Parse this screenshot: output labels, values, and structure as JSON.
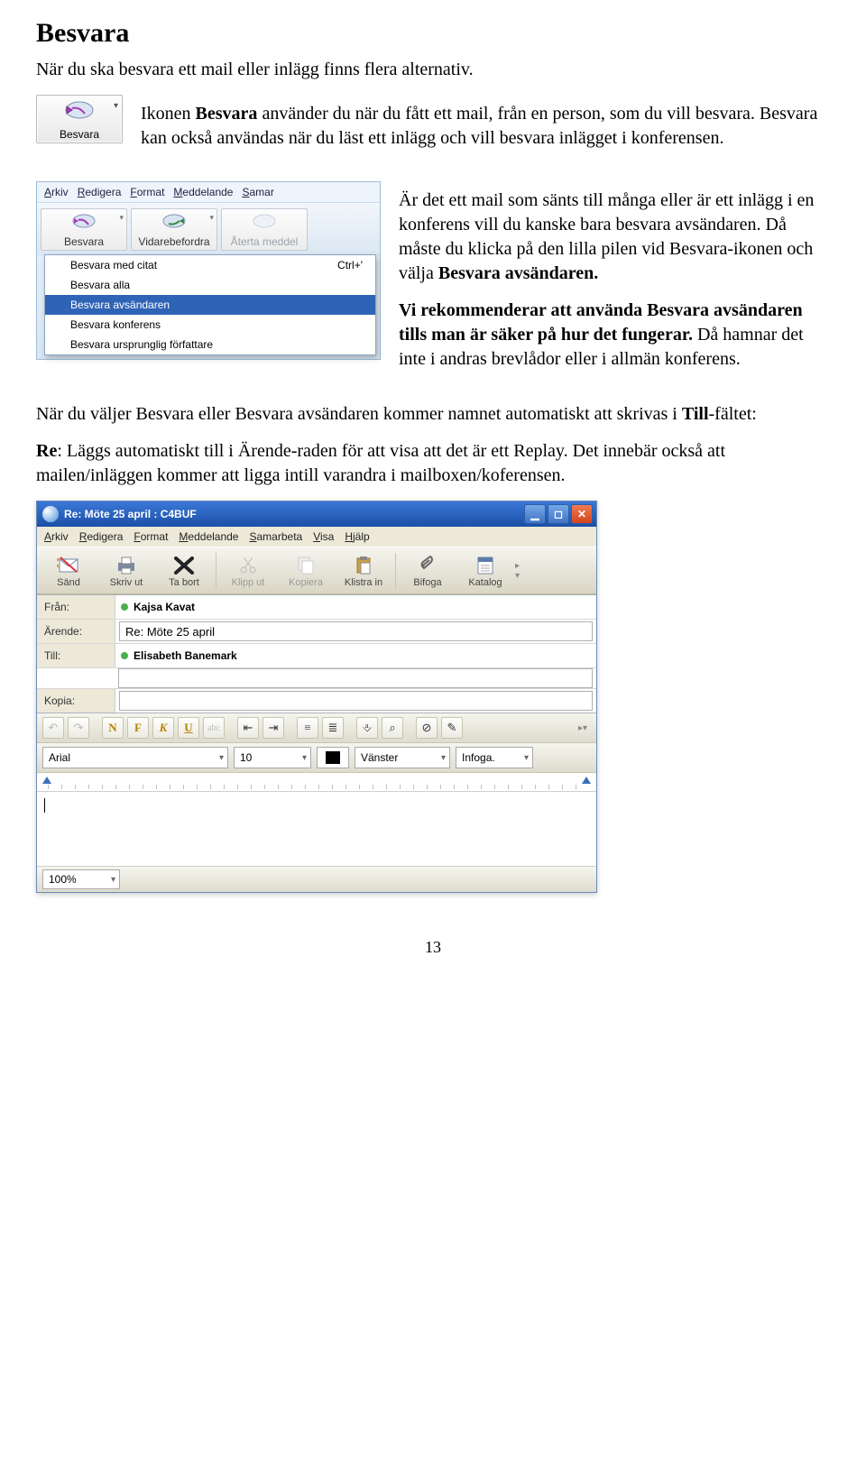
{
  "heading": "Besvara",
  "intro": "När du ska besvara ett mail eller inlägg finns flera alternativ.",
  "para1a": "Ikonen ",
  "para1b": "Besvara",
  "para1c": " använder du när du fått ett mail, från en person, som du vill besvara. Besvara kan också användas när du läst ett inlägg och vill besvara inlägget i konferensen.",
  "para2a": "Är det ett mail som sänts till många eller är ett inlägg i en konferens vill du kanske bara besvara avsändaren. Då måste du klicka på den lilla pilen vid Besvara-ikonen och välja ",
  "para2b": "Besvara avsändaren.",
  "para3a": "Vi rekommenderar att använda Besvara avsändaren tills man är säker på hur det fungerar.",
  "para3b": " Då hamnar det inte i andras brevlådor eller i allmän konferens.",
  "para4a": "När du väljer Besvara eller Besvara avsändaren kommer namnet automatiskt att skrivas i ",
  "para4b": "Till",
  "para4c": "-fältet:",
  "para5a": "Re",
  "para5b": ": Läggs automatiskt till i Ärende-raden för att visa att det är ett Replay. Det innebär också att mailen/inläggen kommer att ligga intill varandra i mailboxen/koferensen.",
  "besvara_btn_label": "Besvara",
  "menu_shot": {
    "menubar": [
      "Arkiv",
      "Redigera",
      "Format",
      "Meddelande",
      "Samar"
    ],
    "toolbar": [
      {
        "label": "Besvara",
        "sub": true
      },
      {
        "label": "Vidarebefordra",
        "sub": true
      },
      {
        "label": "Återta meddel",
        "faded": true
      }
    ],
    "dropdown": [
      {
        "label": "Besvara med citat",
        "shortcut": "Ctrl+'"
      },
      {
        "label": "Besvara alla"
      },
      {
        "label": "Besvara avsändaren",
        "selected": true
      },
      {
        "label": "Besvara konferens"
      },
      {
        "label": "Besvara ursprunglig författare"
      }
    ]
  },
  "compose": {
    "title": "Re: Möte 25 april : C4BUF",
    "menubar": [
      "Arkiv",
      "Redigera",
      "Format",
      "Meddelande",
      "Samarbeta",
      "Visa",
      "Hjälp"
    ],
    "toolbar": [
      {
        "label": "Sänd"
      },
      {
        "label": "Skriv ut"
      },
      {
        "label": "Ta bort"
      },
      {
        "label": "Klipp ut",
        "faded": true
      },
      {
        "label": "Kopiera",
        "faded": true
      },
      {
        "label": "Klistra in"
      },
      {
        "label": "Bifoga"
      },
      {
        "label": "Katalog"
      }
    ],
    "headers": {
      "from_label": "Från:",
      "from_value": "Kajsa Kavat",
      "subj_label": "Ärende:",
      "subj_value": "Re: Möte 25 april",
      "to_label": "Till:",
      "to_value": "Elisabeth Banemark",
      "cc_label": "Kopia:",
      "cc_value": ""
    },
    "fmt1": [
      "↶",
      "↷",
      "|",
      "N",
      "F",
      "K",
      "U",
      "abc",
      "|",
      "≔",
      "≕",
      "|",
      "•",
      "1.",
      "|",
      "⎀",
      "⌕",
      "|",
      "⊘",
      "✎"
    ],
    "font": "Arial",
    "size": "10",
    "align": "Vänster",
    "insert": "Infoga.",
    "zoom": "100%"
  },
  "page_number": "13"
}
